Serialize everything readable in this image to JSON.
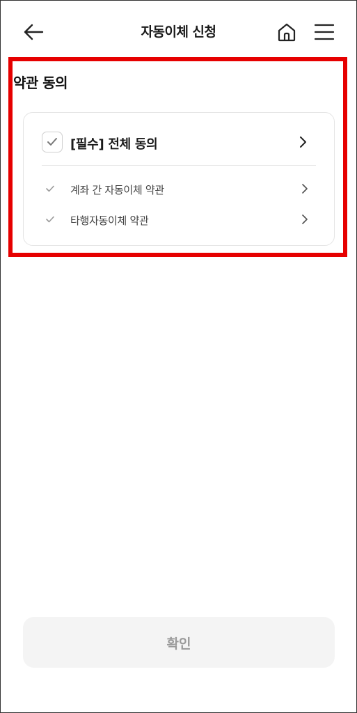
{
  "header": {
    "title": "자동이체 신청",
    "back_icon": "arrow-left-icon",
    "home_icon": "home-icon",
    "menu_icon": "hamburger-menu-icon"
  },
  "terms": {
    "section_title": "약관 동의",
    "all_agree_label": "[필수] 전체 동의",
    "all_agree_checked": false,
    "items": [
      {
        "label": "계좌 간 자동이체 약관"
      },
      {
        "label": "타행자동이체 약관"
      }
    ]
  },
  "footer": {
    "confirm_label": "확인",
    "confirm_enabled": false
  },
  "colors": {
    "highlight": "#e60000",
    "card_border": "#e4e4e4",
    "button_bg": "#f4f4f4",
    "button_text_disabled": "#9a9a9a"
  }
}
